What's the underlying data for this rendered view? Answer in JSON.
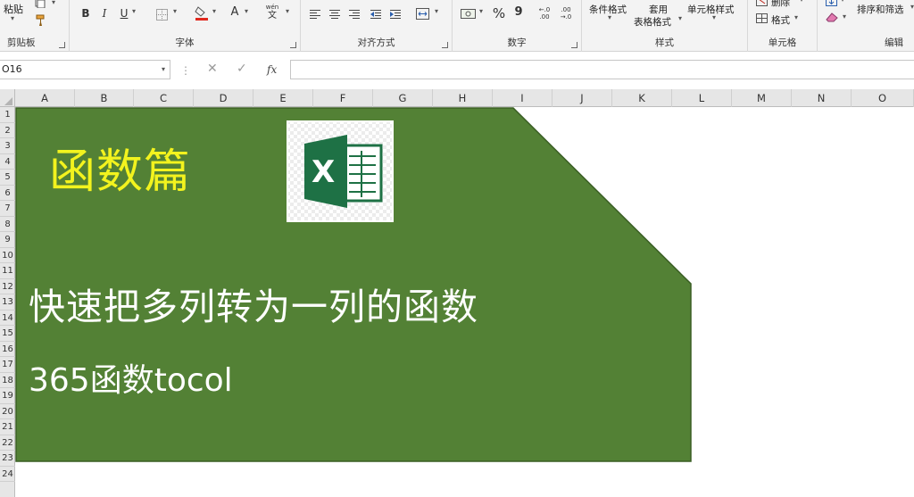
{
  "ribbon": {
    "clipboard": {
      "label": "剪贴板",
      "paste": "粘贴"
    },
    "font": {
      "label": "字体",
      "bold": "B",
      "italic": "I",
      "underline": "U",
      "font_color_glyph": "A",
      "wen_top": "wén",
      "wen_bottom": "文"
    },
    "alignment": {
      "label": "对齐方式"
    },
    "number": {
      "label": "数字",
      "percent": "%",
      "comma": "9",
      "inc_decimal": "←.0\n.00",
      "dec_decimal": ".00\n→.0"
    },
    "styles": {
      "label": "样式",
      "conditional_format": "条件格式",
      "table_format_line1": "套用",
      "table_format_line2": "表格格式",
      "cell_styles": "单元格样式"
    },
    "cells": {
      "label": "单元格",
      "delete": "删除",
      "format": "格式"
    },
    "editing": {
      "label": "编辑",
      "sort_filter": "排序和筛选"
    }
  },
  "formula_bar": {
    "name_box": "O16",
    "cancel": "✕",
    "enter": "✓",
    "fx": "fx",
    "value": ""
  },
  "columns": [
    "A",
    "B",
    "C",
    "D",
    "E",
    "F",
    "G",
    "H",
    "I",
    "J",
    "K",
    "L",
    "M",
    "N",
    "O"
  ],
  "rows": [
    "1",
    "2",
    "3",
    "4",
    "5",
    "6",
    "7",
    "8",
    "9",
    "10",
    "11",
    "12",
    "13",
    "14",
    "15",
    "16",
    "17",
    "18",
    "19",
    "20",
    "21",
    "22",
    "23",
    "24"
  ],
  "banner": {
    "category": "函数篇",
    "title": "快速把多列转为一列的函数",
    "subtitle": "365函数tocol",
    "logo_letter": "X",
    "colors": {
      "fill": "#538135",
      "category_text": "#f3f31e",
      "title_text": "#ffffff",
      "logo_green": "#1e7145"
    }
  }
}
